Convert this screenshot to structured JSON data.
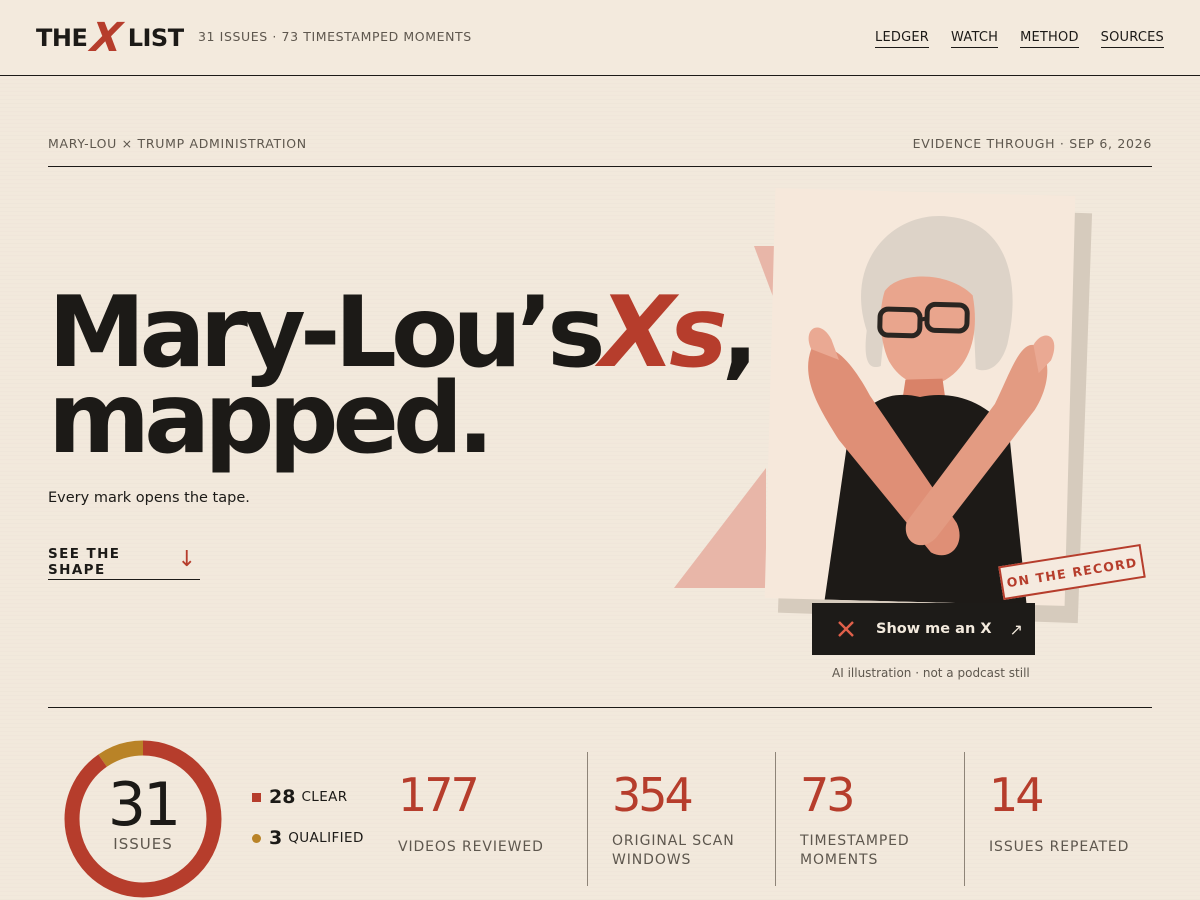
{
  "header": {
    "logo": {
      "prefix": "THE",
      "mark": "X",
      "suffix": "LIST"
    },
    "tagline": "31 ISSUES · 73 TIMESTAMPED MOMENTS",
    "nav": [
      "LEDGER",
      "WATCH",
      "METHOD",
      "SOURCES"
    ]
  },
  "meta": {
    "left": "MARY-LOU × TRUMP ADMINISTRATION",
    "right": "EVIDENCE THROUGH · SEP 6, 2026"
  },
  "hero": {
    "headline_part1": "Mary-Lou’s",
    "headline_xs": "Xs",
    "headline_comma": ",",
    "headline_line2": "mapped.",
    "subline": "Every mark opens the tape.",
    "cta_label": "SEE THE SHAPE",
    "cta_icon": "arrow-down-icon"
  },
  "illustration": {
    "stamp": "ON THE RECORD",
    "button_label": "Show me an X",
    "button_icons": [
      "x-icon",
      "external-arrow-icon"
    ],
    "caption": "AI illustration · not a podcast still"
  },
  "stats": {
    "donut": {
      "total": "31",
      "label": "ISSUES",
      "clear": 28,
      "qualified": 3
    },
    "legend": [
      {
        "num": "28",
        "label": "CLEAR",
        "color": "#b63d2c"
      },
      {
        "num": "3",
        "label": "QUALIFIED",
        "color": "#b98327"
      }
    ],
    "items": [
      {
        "value": "177",
        "label": "VIDEOS REVIEWED"
      },
      {
        "value": "354",
        "label": "ORIGINAL SCAN WINDOWS"
      },
      {
        "value": "73",
        "label": "TIMESTAMPED MOMENTS"
      },
      {
        "value": "14",
        "label": "ISSUES REPEATED"
      }
    ]
  },
  "colors": {
    "accent": "#b63d2c",
    "gold": "#b98327",
    "ink": "#1c1a17",
    "paper": "#f2e9dc"
  }
}
